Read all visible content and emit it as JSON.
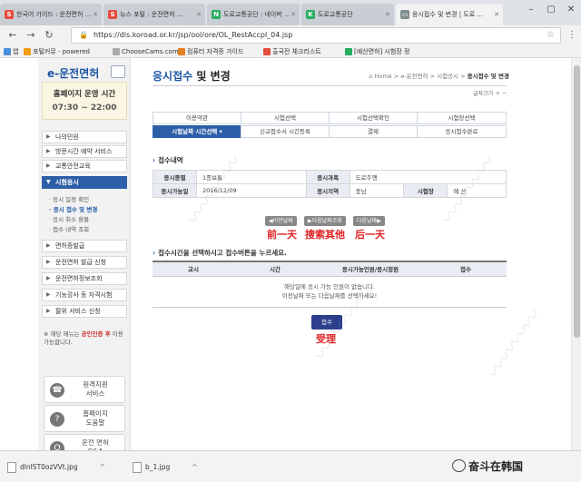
{
  "browser": {
    "tabs": [
      {
        "label": "한국어 가이드 : 운전면허 ...",
        "color": "#e74c3c",
        "icon": "S"
      },
      {
        "label": "뉴스 포털 : 운전면허 ...",
        "color": "#e74c3c",
        "icon": "S"
      },
      {
        "label": "도로교통공단 : 네이버 ...",
        "color": "#27ae60",
        "icon": "N"
      },
      {
        "label": "도로교통공단",
        "color": "#27ae60",
        "icon": "K"
      },
      {
        "label": "응시접수 및 변경 | 도로 ...",
        "color": "#7f8c8d",
        "icon": "▭"
      }
    ],
    "url": "https://dls.koroad.or.kr/jsp/ool/ore/OL_RestAccpl_04.jsp",
    "bookmarks": [
      {
        "label": "앱",
        "color": "#4a90d9"
      },
      {
        "label": "포털커뮤 - powered",
        "color": "#f39c12"
      },
      {
        "label": "ChooseCams.com",
        "color": "#aaaaaa"
      },
      {
        "label": "컴퓨터 자격증 가이드",
        "color": "#e67e22"
      },
      {
        "label": "출국전 체크리스트",
        "color": "#e74c3c"
      },
      {
        "label": "[예산면허] 시험장 정",
        "color": "#27ae60"
      }
    ]
  },
  "sidebar": {
    "logo": "e-운전면허",
    "hours_title": "홈페이지 운영 시간",
    "hours_time": "07:30 ~ 22:00",
    "menu": [
      {
        "label": "나의민원"
      },
      {
        "label": "방문시간 예약 서비스"
      },
      {
        "label": "교통안전교육"
      },
      {
        "label": "시험응시"
      },
      {
        "label": "면허증발급"
      },
      {
        "label": "운전면허 발급 신청"
      },
      {
        "label": "운전면허정보조회"
      },
      {
        "label": "기능강사 등 자격시험"
      },
      {
        "label": "팔위 서비스 신청"
      }
    ],
    "submenu": [
      {
        "label": "응시 일정 확인"
      },
      {
        "label": "응시 접수 및 변경"
      },
      {
        "label": "응시 취소 환불"
      },
      {
        "label": "접수 내역 조회"
      }
    ],
    "note_prefix": "※ 해당 메뉴는 ",
    "note_link": "공인인증 후",
    "note_suffix": " 이용가능합니다.",
    "quick": [
      {
        "label": "원격지원\n서비스",
        "icon": "☎"
      },
      {
        "label": "홈페이지\n도움말",
        "icon": "?"
      },
      {
        "label": "운전 면허\nQ&A",
        "icon": "Q"
      }
    ]
  },
  "content": {
    "title_main": "응시접수",
    "title_bold": " 및 변경",
    "breadcrumb_path": "⌂ Home > e-운전면허 > 시험응시 > ",
    "breadcrumb_current": "응시접수 및 변경",
    "font_control": "글자크기 ＋ －",
    "steps_row1": [
      "이용약관",
      "시험선택",
      "시험선택확인",
      "시험장선택"
    ],
    "steps_row2": [
      "시험날짜 시간선택 ▾",
      "신규접수서 시간등록",
      "결제",
      "응시접수완료"
    ],
    "section1_title": "접수내역",
    "info": {
      "exam_type_label": "응시종별",
      "exam_type_value": "1종보통",
      "exam_subject_label": "응시과목",
      "exam_subject_value": "도로주행",
      "exam_date_label": "응시가능일",
      "exam_date_value": "2016/12/09",
      "region_label": "응시지역",
      "region_value": "충남",
      "site_label": "시험장",
      "site_value": "예 산"
    },
    "nav_buttons": [
      "◀이전날짜",
      "▶다음날짜조회",
      "다음날짜▶"
    ],
    "nav_annotations": [
      "前一天",
      "搜索其他",
      "后一天"
    ],
    "section2_title": "접수시간을 선택하시고 접수버튼을 누르세요.",
    "table_headers": [
      "교시",
      "시간",
      "응시가능인원/응시정원",
      "접수"
    ],
    "table_empty_line1": "해당일에 응시 가능 인원이 없습니다.",
    "table_empty_line2": "이전날짜 또는 다음날짜를 선택하세요!",
    "apply_button": "접수",
    "apply_annotation": "受理"
  },
  "downloads": [
    {
      "name": "dlnIST0ozVVt.jpg"
    },
    {
      "name": "b_1.jpg"
    }
  ],
  "brand_overlay": "奋斗在韩国"
}
